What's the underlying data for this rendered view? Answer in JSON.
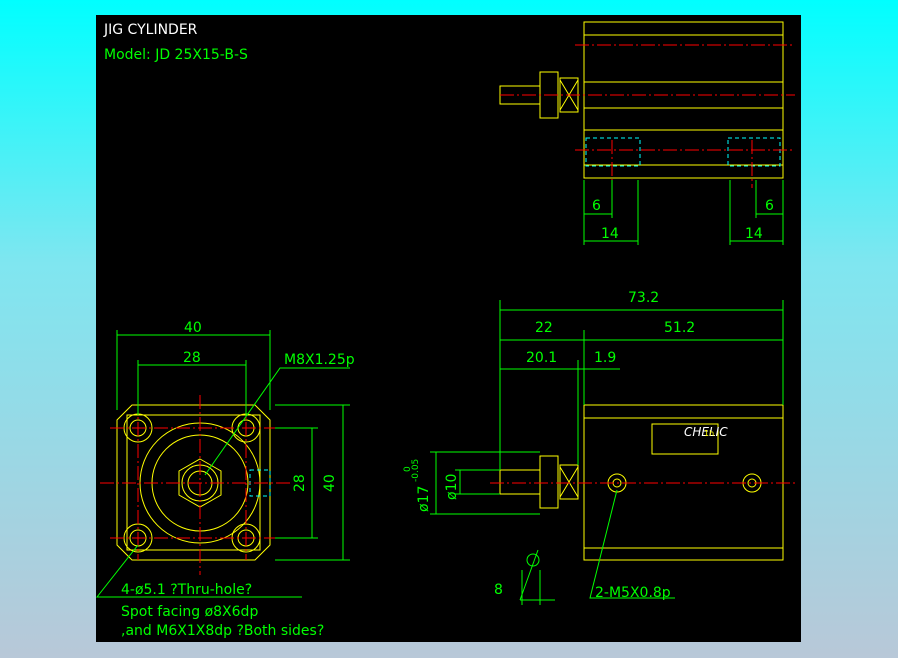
{
  "title": "JIG CYLINDER",
  "model": "Model:  JD 25X15-B-S",
  "dims": {
    "top_left_6": "6",
    "top_right_6": "6",
    "top_left_14": "14",
    "top_right_14": "14",
    "overall": "73.2",
    "rod_len": "22",
    "body_len": "51.2",
    "rod_thread": "20.1",
    "gap": "1.9",
    "rod_dia": "ø10",
    "boss_dia": "ø17",
    "boss_tol_upper": "0",
    "boss_tol_lower": "-0.05",
    "flat": "8",
    "port": "2-M5X0.8p",
    "width": "40",
    "pitch": "28",
    "height": "40",
    "vpitch": "28",
    "thread": "M8X1.25p"
  },
  "notes": [
    "4-ø5.1 ?Thru-hole?",
    "Spot facing  ø8X6dp",
    ",and  M6X1X8dp ?Both sides?"
  ],
  "label": {
    "brand": "CHELIC",
    "suffix": "1h"
  },
  "colors": {
    "background": "#000000",
    "dimension": "#00ff00",
    "outline": "#ffff00",
    "centerline": "#ff0000",
    "hidden": "#00ffff"
  }
}
